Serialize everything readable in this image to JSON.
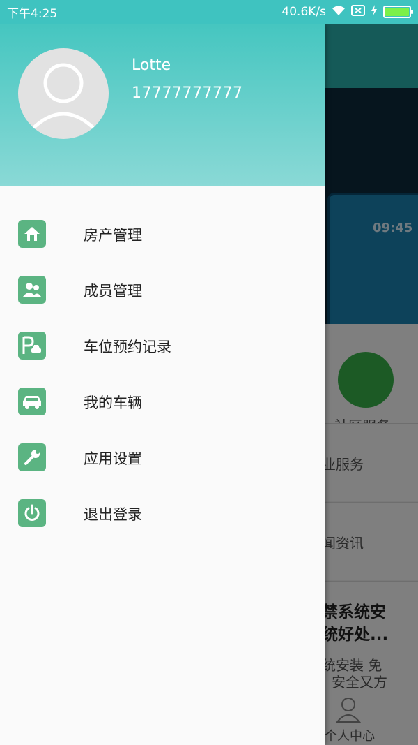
{
  "status_bar": {
    "time": "下午4:25",
    "network_speed": "40.6K/s",
    "battery_level": 1.0,
    "icons": [
      "wifi-icon",
      "sim-icon",
      "charging-icon",
      "battery-icon"
    ]
  },
  "drawer": {
    "user": {
      "name": "Lotte",
      "phone": "17777777777"
    },
    "menu": [
      {
        "label": "房产管理",
        "icon": "house-icon"
      },
      {
        "label": "成员管理",
        "icon": "members-icon"
      },
      {
        "label": "车位预约记录",
        "icon": "parking-icon"
      },
      {
        "label": "我的车辆",
        "icon": "car-icon"
      },
      {
        "label": "应用设置",
        "icon": "wrench-icon"
      },
      {
        "label": "退出登录",
        "icon": "power-icon"
      }
    ]
  },
  "background": {
    "banner_time": "09:45",
    "community_service": "社区服务",
    "property_service": "业服务",
    "news": "闻资讯",
    "article_title_line1": "禁系统安",
    "article_title_line2": "统好处...",
    "article_desc_line1": "统安装 免",
    "article_desc_line2": "安全又方",
    "tab_personal": "个人中心"
  },
  "colors": {
    "accent": "#3fc3c0",
    "menu_icon_bg": "#5bb482"
  }
}
